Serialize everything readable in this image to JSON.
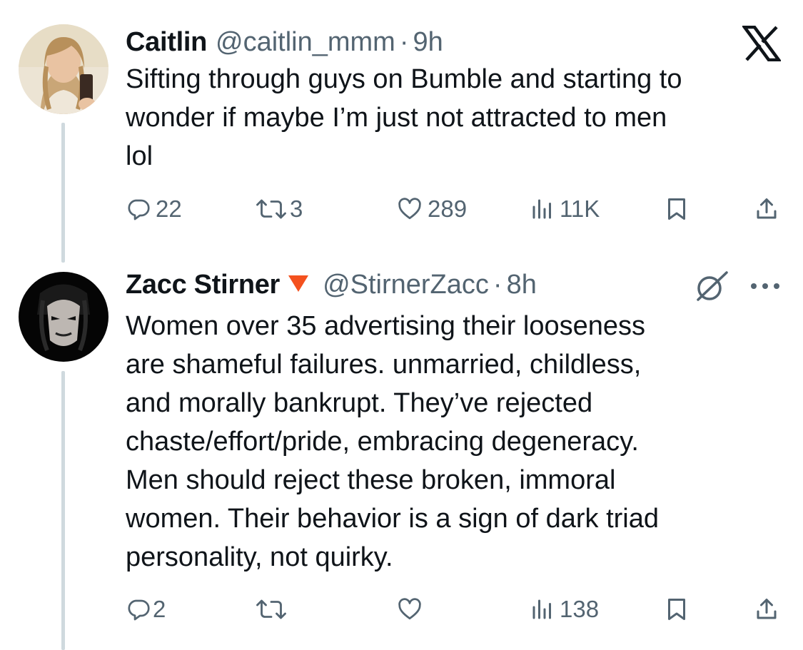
{
  "tweets": [
    {
      "name": "Caitlin",
      "handle": "@caitlin_mmm",
      "separator": "·",
      "time": "9h",
      "lines": [
        "Sifting through guys on Bumble and starting to",
        "wonder if maybe I’m just not attracted to men",
        "lol"
      ],
      "stats": {
        "replies": "22",
        "retweets": "3",
        "likes": "289",
        "views": "11K"
      },
      "corner_icon": "x-logo-icon"
    },
    {
      "name": "Zacc Stirner",
      "name_badge": "red-triangle-icon",
      "handle": "@StirnerZacc",
      "separator": "·",
      "time": "8h",
      "lines": [
        "Women over 35 advertising their looseness",
        "are shameful failures. unmarried, childless,",
        "and morally bankrupt. They’ve rejected",
        "chaste/effort/pride, embracing degeneracy.",
        "Men should reject these broken, immoral",
        "women. Their behavior is a sign of dark triad",
        "personality, not quirky."
      ],
      "stats": {
        "replies": "2",
        "retweets": "",
        "likes": "",
        "views": "138"
      },
      "corner_icons": [
        "grok-icon",
        "more-options-icon"
      ]
    }
  ],
  "colors": {
    "text": "#0f1419",
    "muted": "#536471",
    "thread_line": "#cfd9de",
    "badge_red": "#f4511e"
  }
}
